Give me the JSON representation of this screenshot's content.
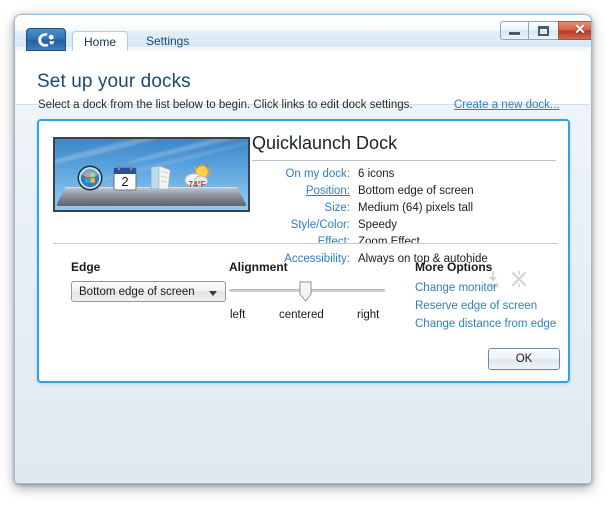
{
  "window": {
    "controls": {
      "minimize": "Minimize",
      "maximize": "Maximize",
      "close": "✕"
    }
  },
  "tabs": [
    {
      "id": "home",
      "label": "Home",
      "active": true
    },
    {
      "id": "settings",
      "label": "Settings",
      "active": false
    }
  ],
  "logo": {
    "name": "objectdock-logo-icon"
  },
  "header": {
    "title": "Set up your docks",
    "subtitle": "Select a dock from the list below to begin. Click links to edit dock settings.",
    "create_link": "Create a new dock..."
  },
  "dock_card": {
    "name": "Quicklaunch Dock",
    "preview": {
      "icons": [
        "windows-orb-icon",
        "calendar-icon",
        "notes-icon",
        "weather-icon"
      ],
      "calendar_day": "2",
      "weather_temp": "74°F"
    },
    "properties": [
      {
        "label": "On my dock:",
        "value": "6 icons",
        "is_link": false
      },
      {
        "label": "Position:",
        "value": "Bottom edge of screen",
        "is_link": true
      },
      {
        "label": "Size:",
        "value": "Medium (64) pixels tall",
        "is_link": false
      },
      {
        "label": "Style/Color:",
        "value": "Speedy",
        "is_link": false
      },
      {
        "label": "Effect:",
        "value": "Zoom Effect",
        "is_link": false
      },
      {
        "label": "Accessibility:",
        "value": "Always on top & autohide",
        "is_link": false
      }
    ],
    "prop_icons": [
      {
        "name": "download-dock-icon"
      },
      {
        "name": "delete-dock-icon"
      }
    ],
    "edge": {
      "heading": "Edge",
      "selected": "Bottom edge of screen"
    },
    "alignment": {
      "heading": "Alignment",
      "value": "centered",
      "ticks": [
        "left",
        "centered",
        "right"
      ]
    },
    "more_options": {
      "heading": "More Options",
      "links": [
        "Change monitor",
        "Reserve edge of screen",
        "Change distance from edge"
      ]
    },
    "ok_label": "OK"
  },
  "colors": {
    "accent_blue": "#2fa3e8",
    "link_blue": "#2f7fbe",
    "title_blue": "#1b4a70",
    "close_red": "#b93a23"
  }
}
